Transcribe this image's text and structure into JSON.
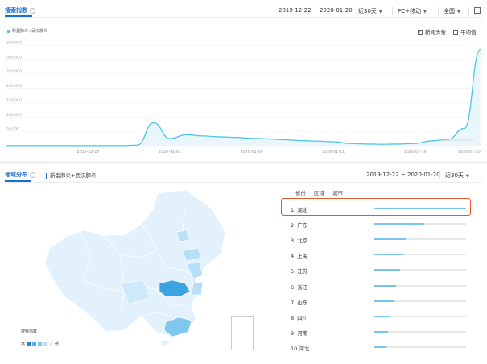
{
  "search_panel": {
    "tab_title": "搜索指数",
    "date_range": "2019-12-22 ~ 2020-01-20",
    "period": "近30天",
    "device": "PC+移动",
    "region": "全国",
    "legend_label": "新型肺炎+武汉肺炎",
    "options": [
      {
        "label": "新闻头条",
        "checked": true
      },
      {
        "label": "平均值",
        "checked": false
      }
    ],
    "watermark": "index.baidu.com"
  },
  "chart_data": {
    "type": "area",
    "title": "",
    "xlabel": "",
    "ylabel": "",
    "ylim": [
      0,
      350000
    ],
    "y_ticks": [
      "350,000",
      "300,000",
      "250,000",
      "200,000",
      "150,000",
      "100,000",
      "50,000"
    ],
    "x_tick_labels": [
      "2019-12-27",
      "2020-01-01",
      "2020-01-06",
      "2020-01-11",
      "2020-01-16",
      "2020-01-20"
    ],
    "grid": true,
    "color": "#4dc4ec",
    "series": [
      {
        "name": "新型肺炎+武汉肺炎",
        "x": [
          "2019-12-22",
          "2019-12-23",
          "2019-12-24",
          "2019-12-25",
          "2019-12-26",
          "2019-12-27",
          "2019-12-28",
          "2019-12-29",
          "2019-12-30",
          "2019-12-31",
          "2020-01-01",
          "2020-01-02",
          "2020-01-03",
          "2020-01-04",
          "2020-01-05",
          "2020-01-06",
          "2020-01-07",
          "2020-01-08",
          "2020-01-09",
          "2020-01-10",
          "2020-01-11",
          "2020-01-12",
          "2020-01-13",
          "2020-01-14",
          "2020-01-15",
          "2020-01-16",
          "2020-01-17",
          "2020-01-18",
          "2020-01-19",
          "2020-01-20"
        ],
        "values": [
          300,
          300,
          300,
          300,
          300,
          300,
          300,
          300,
          2000,
          80000,
          25000,
          38000,
          34000,
          31000,
          29000,
          26000,
          24000,
          21000,
          18000,
          16000,
          14000,
          8000,
          6000,
          5000,
          6000,
          8000,
          17000,
          22000,
          60000,
          335000
        ]
      }
    ]
  },
  "region_panel": {
    "tab_title": "地域分布",
    "keyword": "新型肺炎+武汉肺炎",
    "date_range": "2019-12-22 ~ 2020-01-20",
    "period": "近30天",
    "tabs": [
      "省份",
      "区域",
      "城市"
    ],
    "map_legend_title": "搜索指数",
    "map_legend_low": "低",
    "map_legend_high": "高",
    "map_colors": [
      "#1e88cf",
      "#4fb1e8",
      "#7ec7ef",
      "#b7dff7",
      "#e2f1fc"
    ],
    "rankings": [
      {
        "label": "1.  湖北",
        "value": 1.0
      },
      {
        "label": "2.  广东",
        "value": 0.55
      },
      {
        "label": "3.  北京",
        "value": 0.35
      },
      {
        "label": "4.  上海",
        "value": 0.33
      },
      {
        "label": "5.  江苏",
        "value": 0.29
      },
      {
        "label": "6.  浙江",
        "value": 0.24
      },
      {
        "label": "7.  山东",
        "value": 0.22
      },
      {
        "label": "8.  四川",
        "value": 0.18
      },
      {
        "label": "9.  河南",
        "value": 0.16
      },
      {
        "label": "10.河北",
        "value": 0.14
      }
    ]
  }
}
